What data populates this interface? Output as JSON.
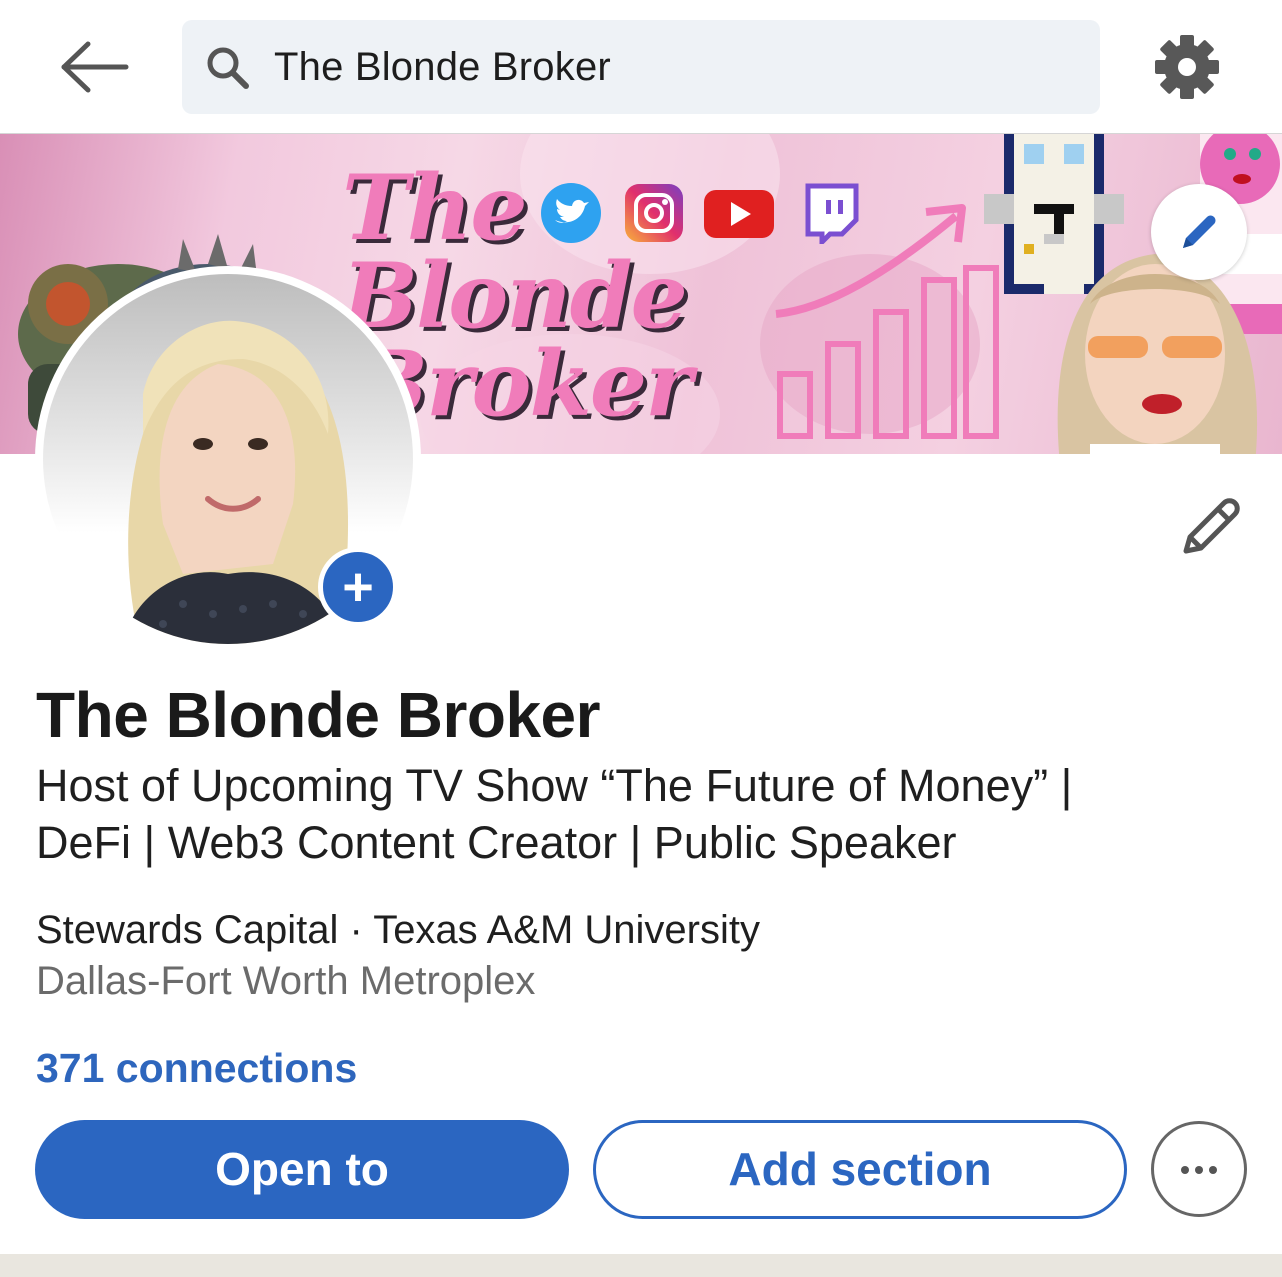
{
  "search": {
    "query": "The Blonde Broker"
  },
  "banner": {
    "title_lines": [
      "The",
      "Blonde",
      "Broker"
    ],
    "social_icons": [
      "twitter-icon",
      "instagram-icon",
      "youtube-icon",
      "twitch-icon"
    ],
    "colors": {
      "pink": "#f07cba",
      "background": "#f2c9de"
    }
  },
  "profile": {
    "name": "The Blonde Broker",
    "headline_lines": [
      "Host of Upcoming TV Show “The Future of Money”  |",
      "DeFi | Web3 Content Creator | Public Speaker"
    ],
    "organization": "Stewards Capital · Texas A&M University",
    "location": "Dallas-Fort Worth Metroplex",
    "connections": "371 connections"
  },
  "actions": {
    "primary_label": "Open to",
    "secondary_label": "Add section"
  },
  "colors": {
    "accent": "#2b66c1",
    "link": "#2e66bd",
    "muted_text": "#6b6b6b"
  }
}
